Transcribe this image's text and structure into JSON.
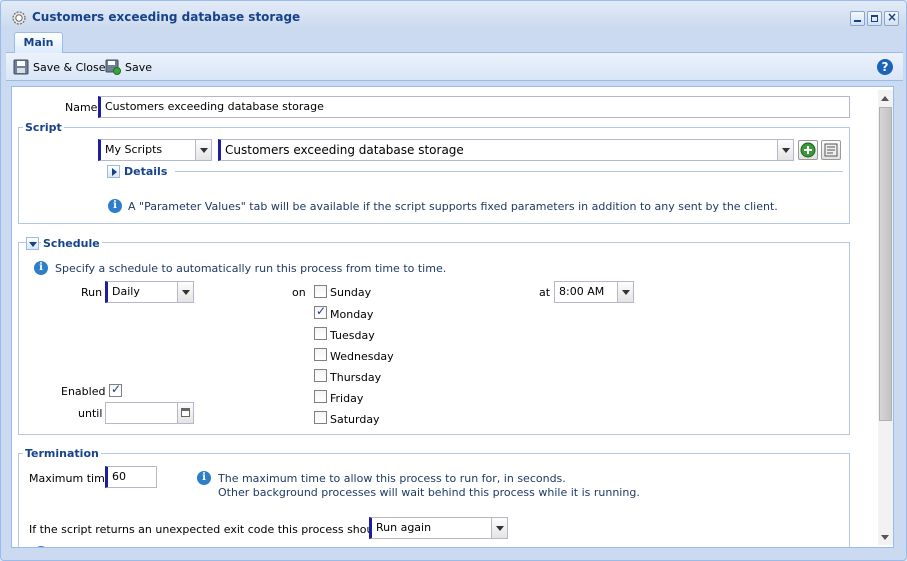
{
  "window": {
    "title": "Customers exceeding database storage",
    "tabs": [
      {
        "label": "Main"
      }
    ]
  },
  "toolbar": {
    "save_close_label": "Save & Close",
    "save_label": "Save",
    "help_glyph": "?"
  },
  "form": {
    "name_label": "Name",
    "name_value": "Customers exceeding database storage",
    "script": {
      "legend": "Script",
      "folder_value": "My Scripts",
      "script_value": "Customers exceeding database storage",
      "details_label": "Details",
      "info_text": "A \"Parameter Values\" tab will be available if the script supports fixed parameters in addition to any sent by the client."
    },
    "schedule": {
      "legend": "Schedule",
      "info_text": "Specify a schedule to automatically run this process from time to time.",
      "run_label": "Run",
      "run_value": "Daily",
      "on_label": "on",
      "days": [
        {
          "label": "Sunday",
          "checked": false
        },
        {
          "label": "Monday",
          "checked": true
        },
        {
          "label": "Tuesday",
          "checked": false
        },
        {
          "label": "Wednesday",
          "checked": false
        },
        {
          "label": "Thursday",
          "checked": false
        },
        {
          "label": "Friday",
          "checked": false
        },
        {
          "label": "Saturday",
          "checked": false
        }
      ],
      "at_label": "at",
      "at_value": "8:00 AM",
      "enabled_label": "Enabled",
      "enabled_checked": true,
      "until_label": "until",
      "until_value": ""
    },
    "termination": {
      "legend": "Termination",
      "max_time_label": "Maximum time",
      "max_time_value": "60",
      "info_line1": "The maximum time to allow this process to run for, in seconds.",
      "info_line2": "Other background processes will wait behind this process while it is running.",
      "exit_code_label": "If the script returns an unexpected exit code this process should be",
      "exit_code_value": "Run again"
    }
  },
  "colors": {
    "accent": "#15428b",
    "field_marker": "#1d1d9f",
    "info": "#2f7fc8"
  }
}
